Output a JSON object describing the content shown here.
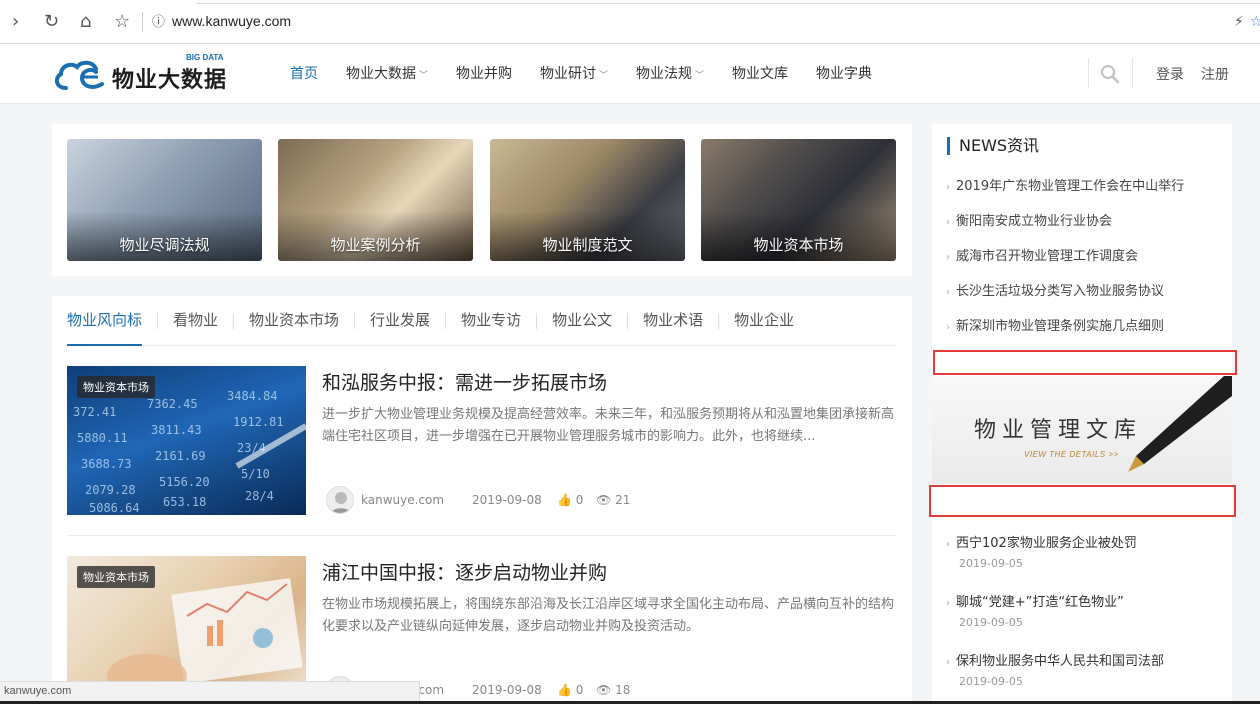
{
  "browser": {
    "url": "www.kanwuye.com",
    "status_url": "kanwuye.com"
  },
  "site": {
    "logo_text": "物业大数据",
    "logo_sub": "BIG DATA",
    "nav": [
      {
        "label": "首页",
        "active": true
      },
      {
        "label": "物业大数据",
        "dropdown": true
      },
      {
        "label": "物业并购"
      },
      {
        "label": "物业研讨",
        "dropdown": true
      },
      {
        "label": "物业法规",
        "dropdown": true
      },
      {
        "label": "物业文库"
      },
      {
        "label": "物业字典"
      }
    ],
    "login": "登录",
    "register": "注册",
    "accent": "#1a6fb3"
  },
  "tiles": [
    {
      "label": "物业尽调法规"
    },
    {
      "label": "物业案例分析"
    },
    {
      "label": "物业制度范文"
    },
    {
      "label": "物业资本市场"
    }
  ],
  "tabs": [
    {
      "label": "物业风向标",
      "active": true
    },
    {
      "label": "看物业"
    },
    {
      "label": "物业资本市场"
    },
    {
      "label": "行业发展"
    },
    {
      "label": "物业专访"
    },
    {
      "label": "物业公文"
    },
    {
      "label": "物业术语"
    },
    {
      "label": "物业企业"
    }
  ],
  "articles": [
    {
      "badge": "物业资本市场",
      "title": "和泓服务中报：需进一步拓展市场",
      "excerpt": "进一步扩大物业管理业务规模及提高经营效率。未来三年，和泓服务预期将从和泓置地集团承接新高端住宅社区项目，进一步增强在已开展物业管理服务城市的影响力。此外，也将继续...",
      "author": "kanwuye.com",
      "date": "2019-09-08",
      "likes": "0",
      "views": "21"
    },
    {
      "badge": "物业资本市场",
      "title": "浦江中国中报：逐步启动物业并购",
      "excerpt": "在物业市场规模拓展上，将围绕东部沿海及长江沿岸区域寻求全国化主动布局、产品横向互补的结构化要求以及产业链纵向延伸发展，逐步启动物业并购及投资活动。",
      "author": "kanwuye.com",
      "date": "2019-09-08",
      "likes": "0",
      "views": "18"
    }
  ],
  "sidebar": {
    "news_title": "NEWS资讯",
    "news": [
      "2019年广东物业管理工作会在中山举行",
      "衡阳南安成立物业行业协会",
      "威海市召开物业管理工作调度会",
      "长沙生活垃圾分类写入物业服务协议",
      "新深圳市物业管理条例实施几点细则"
    ],
    "banner_text": "物业管理文库",
    "banner_sub": "VIEW THE DETAILS >>",
    "latest": [
      {
        "title": "西宁102家物业服务企业被处罚",
        "date": "2019-09-05"
      },
      {
        "title": "聊城“党建+”打造“红色物业”",
        "date": "2019-09-05"
      },
      {
        "title": "保利物业服务中华人民共和国司法部",
        "date": "2019-09-05"
      }
    ]
  }
}
